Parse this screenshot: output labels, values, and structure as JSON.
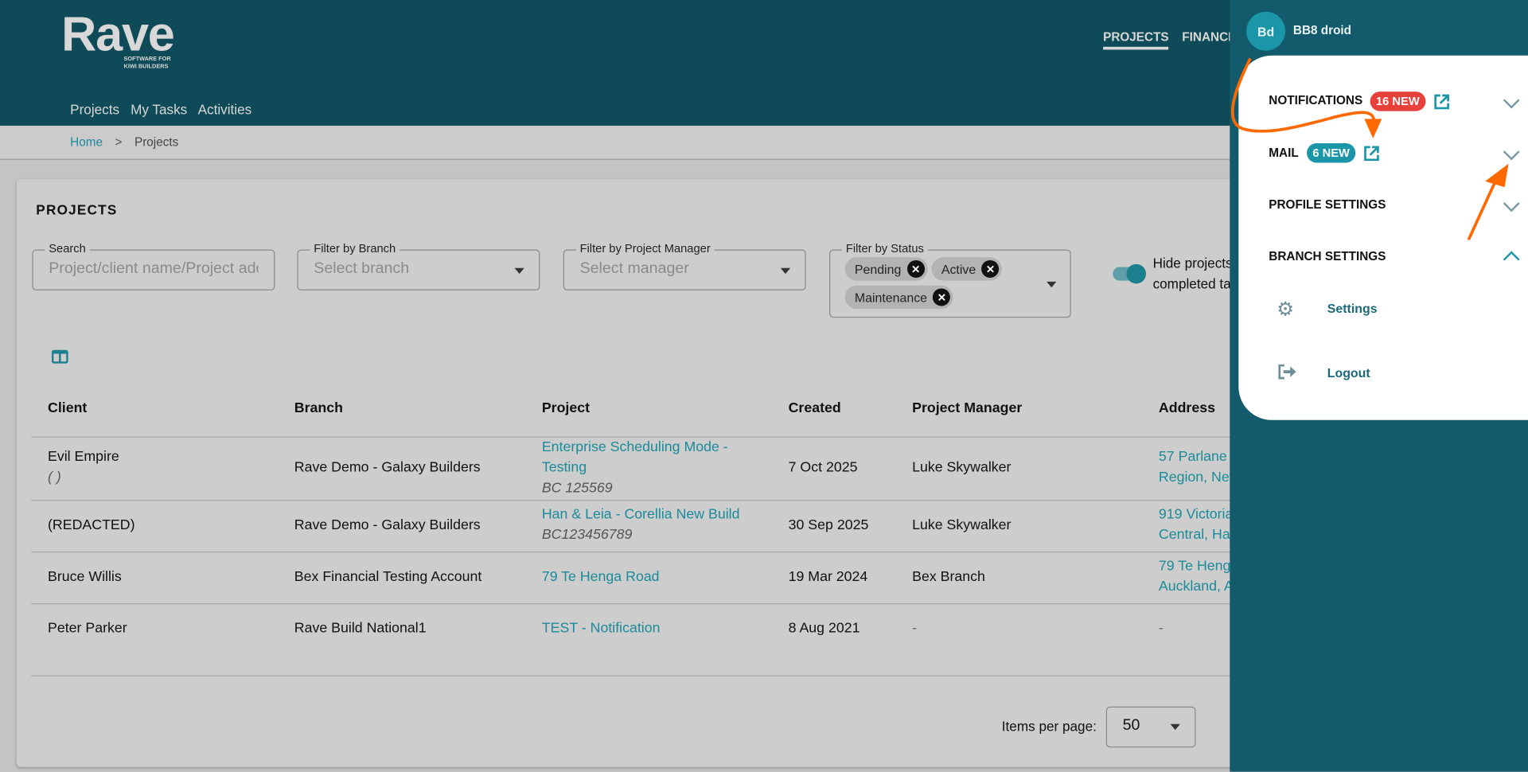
{
  "header": {
    "logo": "Rave",
    "logo_tagline_1": "SOFTWARE FOR",
    "logo_tagline_2": "KIWI BUILDERS",
    "top_nav": [
      "PROJECTS",
      "FINANCI"
    ],
    "sub_nav": [
      "Projects",
      "My Tasks",
      "Activities"
    ]
  },
  "breadcrumb": {
    "home": "Home",
    "separator": ">",
    "current": "Projects"
  },
  "card": {
    "title": "PROJECTS"
  },
  "filters": {
    "search": {
      "label": "Search",
      "placeholder": "Project/client name/Project address"
    },
    "branch": {
      "label": "Filter by Branch",
      "placeholder": "Select branch"
    },
    "manager": {
      "label": "Filter by Project Manager",
      "placeholder": "Select manager"
    },
    "status": {
      "label": "Filter by Status",
      "chips": [
        "Pending",
        "Active",
        "Maintenance"
      ]
    },
    "hide_toggle": {
      "label_1": "Hide projects",
      "label_2": "completed ta",
      "on": true
    }
  },
  "table": {
    "columns": [
      "Client",
      "Branch",
      "Project",
      "Created",
      "Project Manager",
      "Address"
    ],
    "rows": [
      {
        "client": "Evil Empire",
        "client_sub": "( )",
        "branch": "Rave Demo - Galaxy Builders",
        "project_1": "Enterprise Scheduling Mode -",
        "project_2": "Testing",
        "project_code": "BC 125569",
        "created": "7 Oct 2025",
        "manager": "Luke Skywalker",
        "address_1": "57 Parlane",
        "address_2": "Region, New"
      },
      {
        "client": "(REDACTED)",
        "branch": "Rave Demo - Galaxy Builders",
        "project_1": "Han & Leia - Corellia New Build",
        "project_code": "BC123456789",
        "created": "30 Sep 2025",
        "manager": "Luke Skywalker",
        "address_1": "919 Victoria",
        "address_2": "Central, Ham"
      },
      {
        "client": "Bruce Willis",
        "branch": "Bex Financial Testing Account",
        "project_1": "79 Te Henga Road",
        "created": "19 Mar 2024",
        "manager": "Bex Branch",
        "address_1": "79 Te Heng",
        "address_2": "Auckland, A"
      },
      {
        "client": "Peter Parker",
        "branch": "Rave Build National1",
        "project_1": "TEST - Notification",
        "created": "8 Aug 2021",
        "manager": "-",
        "address_1": "-"
      }
    ]
  },
  "pagination": {
    "label": "Items per page:",
    "value": "50"
  },
  "drawer": {
    "avatar": "Bd",
    "user": "BB8 droid",
    "notifications": {
      "label": "NOTIFICATIONS",
      "badge": "16 NEW"
    },
    "mail": {
      "label": "MAIL",
      "badge": "6 NEW"
    },
    "profile": {
      "label": "PROFILE SETTINGS"
    },
    "branch": {
      "label": "BRANCH SETTINGS",
      "items": [
        "Settings",
        "Logout"
      ]
    }
  },
  "colors": {
    "header": "#0e4a57",
    "drawer": "#135b6c",
    "accent": "#1b8a99",
    "red_badge": "#e8413c",
    "annotation": "#ff6a00"
  }
}
